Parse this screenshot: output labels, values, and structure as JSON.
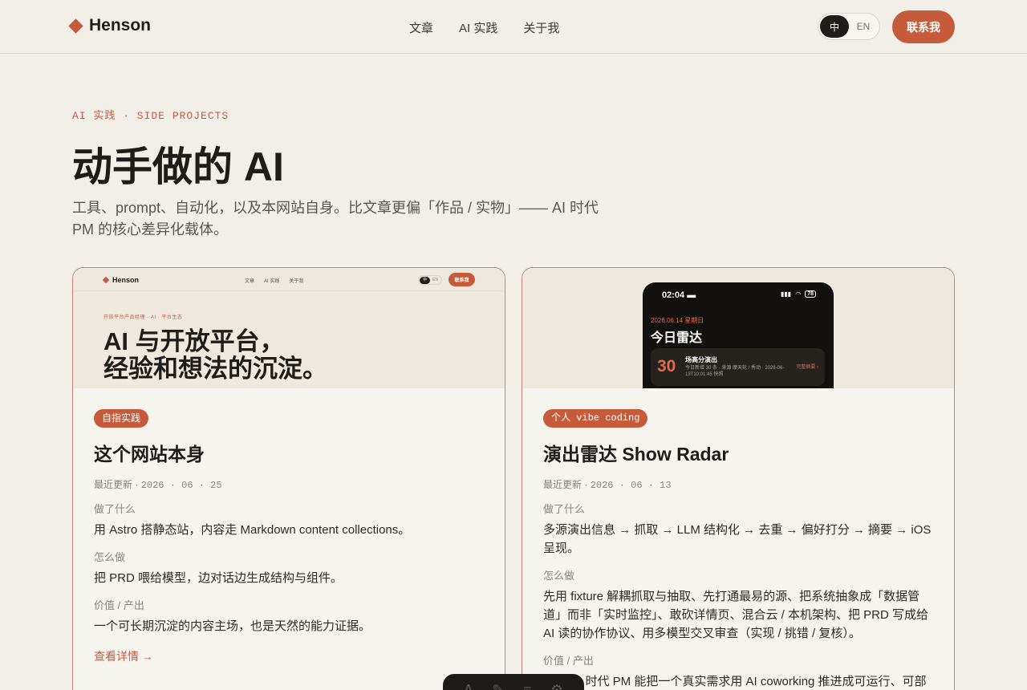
{
  "header": {
    "brand": "Henson",
    "nav": [
      "文章",
      "AI 实践",
      "关于我"
    ],
    "lang": {
      "active": "中",
      "other": "EN"
    },
    "contact": "联系我"
  },
  "hero": {
    "eyebrow": "AI 实践 · SIDE PROJECTS",
    "title": "动手做的 AI",
    "subtitle": "工具、prompt、自动化，以及本网站自身。比文章更偏「作品 / 实物」—— AI 时代 PM 的核心差异化载体。"
  },
  "cards": [
    {
      "thumb": {
        "brand": "Henson",
        "nav": [
          "文章",
          "AI 实践",
          "关于我"
        ],
        "lang_a": "中",
        "lang_b": "EN",
        "btn": "联系我",
        "eyebrow": "开放平台产品经理 · AI · 平台生态",
        "title_line1": "AI 与开放平台，",
        "title_line2": "经验和想法的沉淀。"
      },
      "tag": "自指实践",
      "title": "这个网站本身",
      "meta_label": "最近更新",
      "meta_date": "2026 · 06 · 25",
      "what_label": "做了什么",
      "what": "用 Astro 搭静态站，内容走 Markdown content collections。",
      "how_label": "怎么做",
      "how": "把 PRD 喂给模型，边对话边生成结构与组件。",
      "value_label": "价值 / 产出",
      "value": "一个可长期沉淀的内容主场，也是天然的能力证据。",
      "more": "查看详情 →"
    },
    {
      "thumb": {
        "time": "02:04",
        "battery": "78",
        "date": "2026.06.14 星期日",
        "heading": "今日雷达",
        "count": "30",
        "line1": "场高分演出",
        "line2": "今日新增 30 条 · 来源 摩天轮 / 秀动 · 2026-06-13T10:01:45 快照",
        "link": "完整摘要 ›"
      },
      "tag": "个人 vibe coding",
      "title": "演出雷达 Show Radar",
      "meta_label": "最近更新",
      "meta_date": "2026 · 06 · 13",
      "what_label": "做了什么",
      "what": "多源演出信息 → 抓取 → LLM 结构化 → 去重 → 偏好打分 → 摘要 → iOS 呈现。",
      "how_label": "怎么做",
      "how": "先用 fixture 解耦抓取与抽取、先打通最易的源、把系统抽象成「数据管道」而非「实时监控」、敢砍详情页、混合云 / 本机架构、把 PRD 写成给 AI 读的协作协议、用多模型交叉审查（实现 / 挑错 / 复核）。",
      "value_label": "价值 / 产出",
      "value": "证明 AI 时代 PM 能把一个真实需求用 AI coworking 推进成可运行、可部署、可讲述的数据产品。最值钱的产出不是代码，是「PM 如何管理"
    }
  ],
  "colors": {
    "accent": "#c55b3a",
    "background": "#f2efe9",
    "text": "#1f1d1a"
  }
}
